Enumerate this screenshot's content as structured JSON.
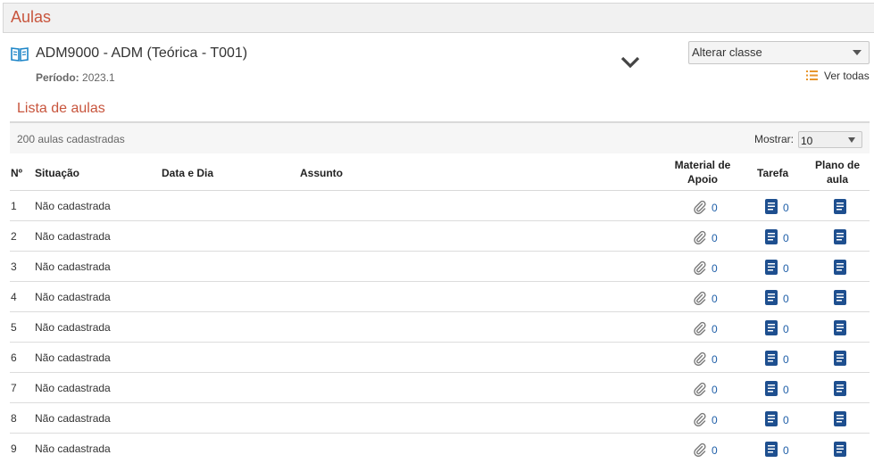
{
  "header": {
    "title": "Aulas"
  },
  "course": {
    "name": "ADM9000 - ADM (Teórica - T001)",
    "period_label": "Período:",
    "period_value": "2023.1"
  },
  "class_select": {
    "value": "Alterar classe"
  },
  "ver_todas": {
    "label": "Ver todas"
  },
  "lista": {
    "title": "Lista de aulas",
    "count_text": "200 aulas cadastradas",
    "mostrar_label": "Mostrar:",
    "mostrar_value": "10"
  },
  "table": {
    "headers": {
      "num": "Nº",
      "situacao": "Situação",
      "data_dia": "Data e Dia",
      "assunto": "Assunto",
      "material_l1": "Material de",
      "material_l2": "Apoio",
      "tarefa": "Tarefa",
      "plano_l1": "Plano de",
      "plano_l2": "aula"
    },
    "rows": [
      {
        "num": "1",
        "situacao": "Não cadastrada",
        "material": "0",
        "tarefa": "0"
      },
      {
        "num": "2",
        "situacao": "Não cadastrada",
        "material": "0",
        "tarefa": "0"
      },
      {
        "num": "3",
        "situacao": "Não cadastrada",
        "material": "0",
        "tarefa": "0"
      },
      {
        "num": "4",
        "situacao": "Não cadastrada",
        "material": "0",
        "tarefa": "0"
      },
      {
        "num": "5",
        "situacao": "Não cadastrada",
        "material": "0",
        "tarefa": "0"
      },
      {
        "num": "6",
        "situacao": "Não cadastrada",
        "material": "0",
        "tarefa": "0"
      },
      {
        "num": "7",
        "situacao": "Não cadastrada",
        "material": "0",
        "tarefa": "0"
      },
      {
        "num": "8",
        "situacao": "Não cadastrada",
        "material": "0",
        "tarefa": "0"
      },
      {
        "num": "9",
        "situacao": "Não cadastrada",
        "material": "0",
        "tarefa": "0"
      }
    ]
  },
  "icons": {
    "book": "open-book-icon",
    "chevron": "chevron-down-icon",
    "list": "list-icon",
    "clip": "paperclip-icon",
    "doc": "document-icon"
  },
  "colors": {
    "accent_title": "#c8553d",
    "link_blue": "#1f5fa8",
    "doc_icon": "#1e4f8f",
    "header_bg": "#f1f1f1",
    "list_icon": "#e8962c"
  }
}
